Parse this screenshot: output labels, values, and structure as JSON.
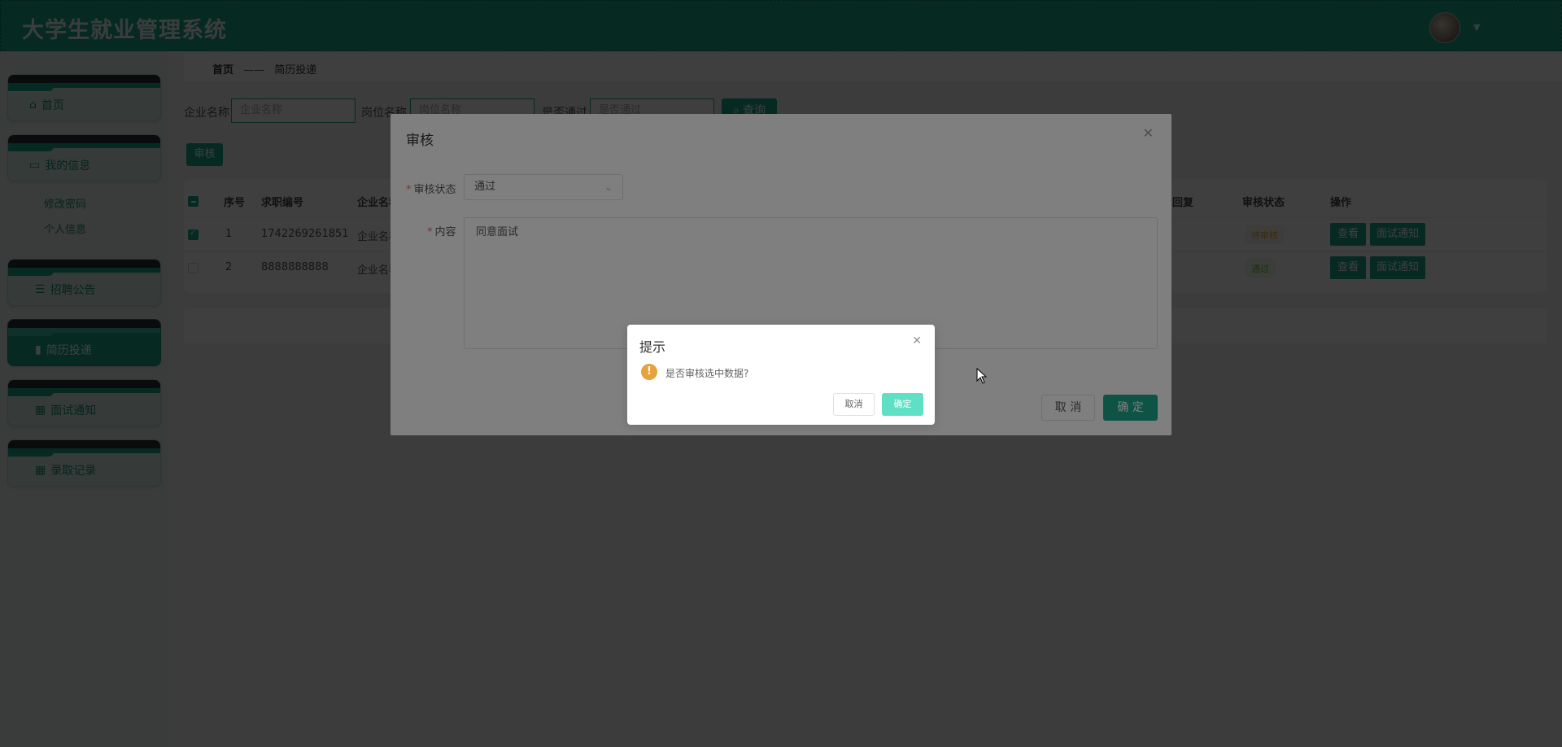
{
  "app": {
    "title": "大学生就业管理系统"
  },
  "sidebar": {
    "items": [
      {
        "label": "首页",
        "icon": "home-icon"
      },
      {
        "label": "我的信息",
        "icon": "card-icon"
      },
      {
        "label": "招聘公告",
        "icon": "sliders-icon"
      },
      {
        "label": "简历投递",
        "icon": "book-icon"
      },
      {
        "label": "面试通知",
        "icon": "grid-icon"
      },
      {
        "label": "录取记录",
        "icon": "grid-icon"
      }
    ],
    "sub_items": [
      "修改密码",
      "个人信息"
    ]
  },
  "breadcrumb": {
    "home": "首页",
    "separator": "——",
    "current": "简历投递"
  },
  "filters": {
    "company_label": "企业名称",
    "company_placeholder": "企业名称",
    "position_label": "岗位名称",
    "position_placeholder": "岗位名称",
    "pass_label": "是否通过",
    "pass_placeholder": "是否通过",
    "query_button": "查询"
  },
  "toolbar": {
    "audit_button": "审核"
  },
  "table": {
    "headers": {
      "index": "序号",
      "id": "求职编号",
      "company": "企业名称",
      "reply": "回复",
      "status": "审核状态",
      "actions": "操作"
    },
    "rows": [
      {
        "index": "1",
        "id": "1742269261851",
        "company": "企业名称",
        "status": "待审核",
        "checked": true
      },
      {
        "index": "2",
        "id": "8888888888",
        "company": "企业名称",
        "status": "通过",
        "checked": false
      }
    ],
    "view_button": "查看",
    "interview_button": "面试通知"
  },
  "audit_dialog": {
    "title": "审核",
    "status_label": "审核状态",
    "status_value": "通过",
    "content_label": "内容",
    "content_value": "同意面试",
    "cancel": "取 消",
    "confirm": "确 定"
  },
  "confirm_box": {
    "title": "提示",
    "message": "是否审核选中数据?",
    "cancel": "取消",
    "confirm": "确定"
  },
  "colors": {
    "primary": "#1aa88a",
    "warning": "#e6a23c"
  }
}
